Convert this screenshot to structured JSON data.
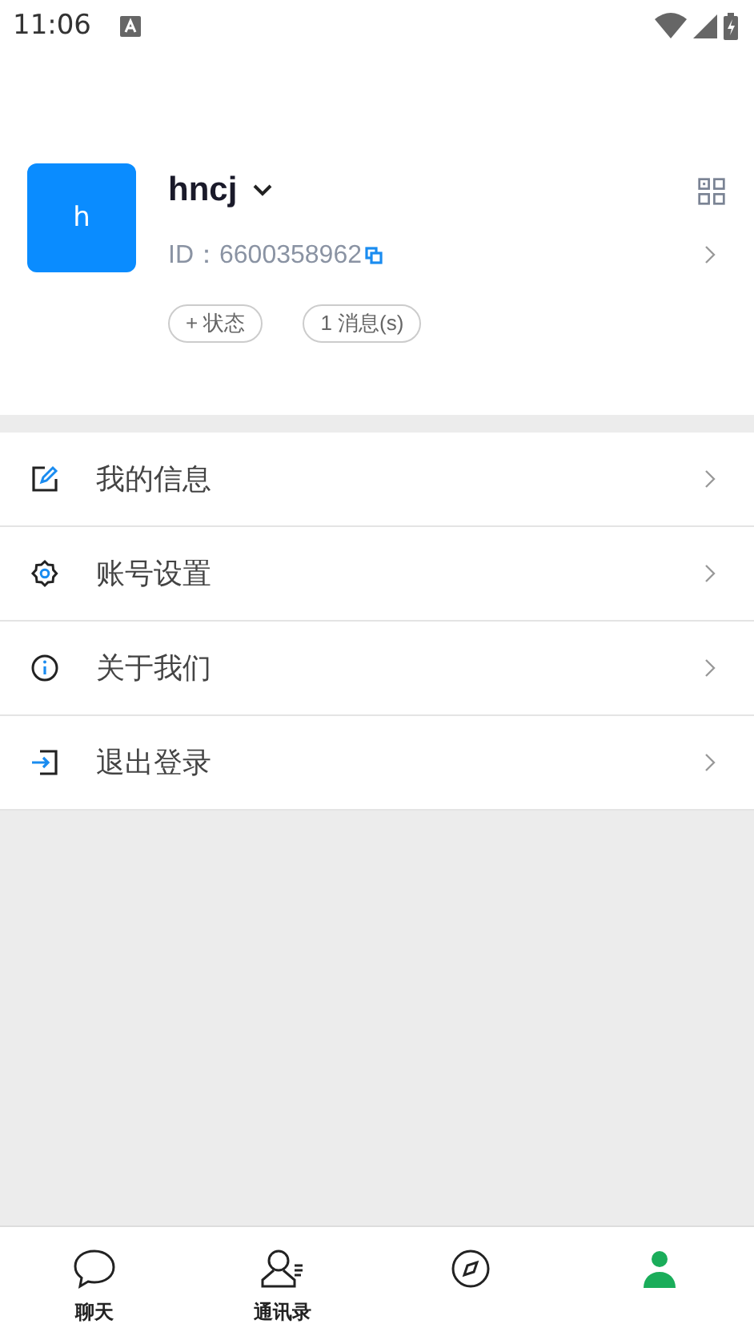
{
  "status_bar": {
    "time": "11:06"
  },
  "profile": {
    "avatar_letter": "h",
    "name": "hncj",
    "id_label": "ID：",
    "id_value": "6600358962",
    "chips": [
      "+ 状态",
      "1 消息(s)"
    ]
  },
  "menu": [
    {
      "kind": "edit",
      "label": "我的信息"
    },
    {
      "kind": "settings",
      "label": "账号设置"
    },
    {
      "kind": "info",
      "label": "关于我们"
    },
    {
      "kind": "logout",
      "label": "退出登录"
    }
  ],
  "tabs": [
    {
      "kind": "chat",
      "label": "聊天",
      "selected": false
    },
    {
      "kind": "contacts",
      "label": "通讯录",
      "selected": false
    },
    {
      "kind": "discover",
      "selected": false
    },
    {
      "kind": "me",
      "selected": true
    }
  ]
}
